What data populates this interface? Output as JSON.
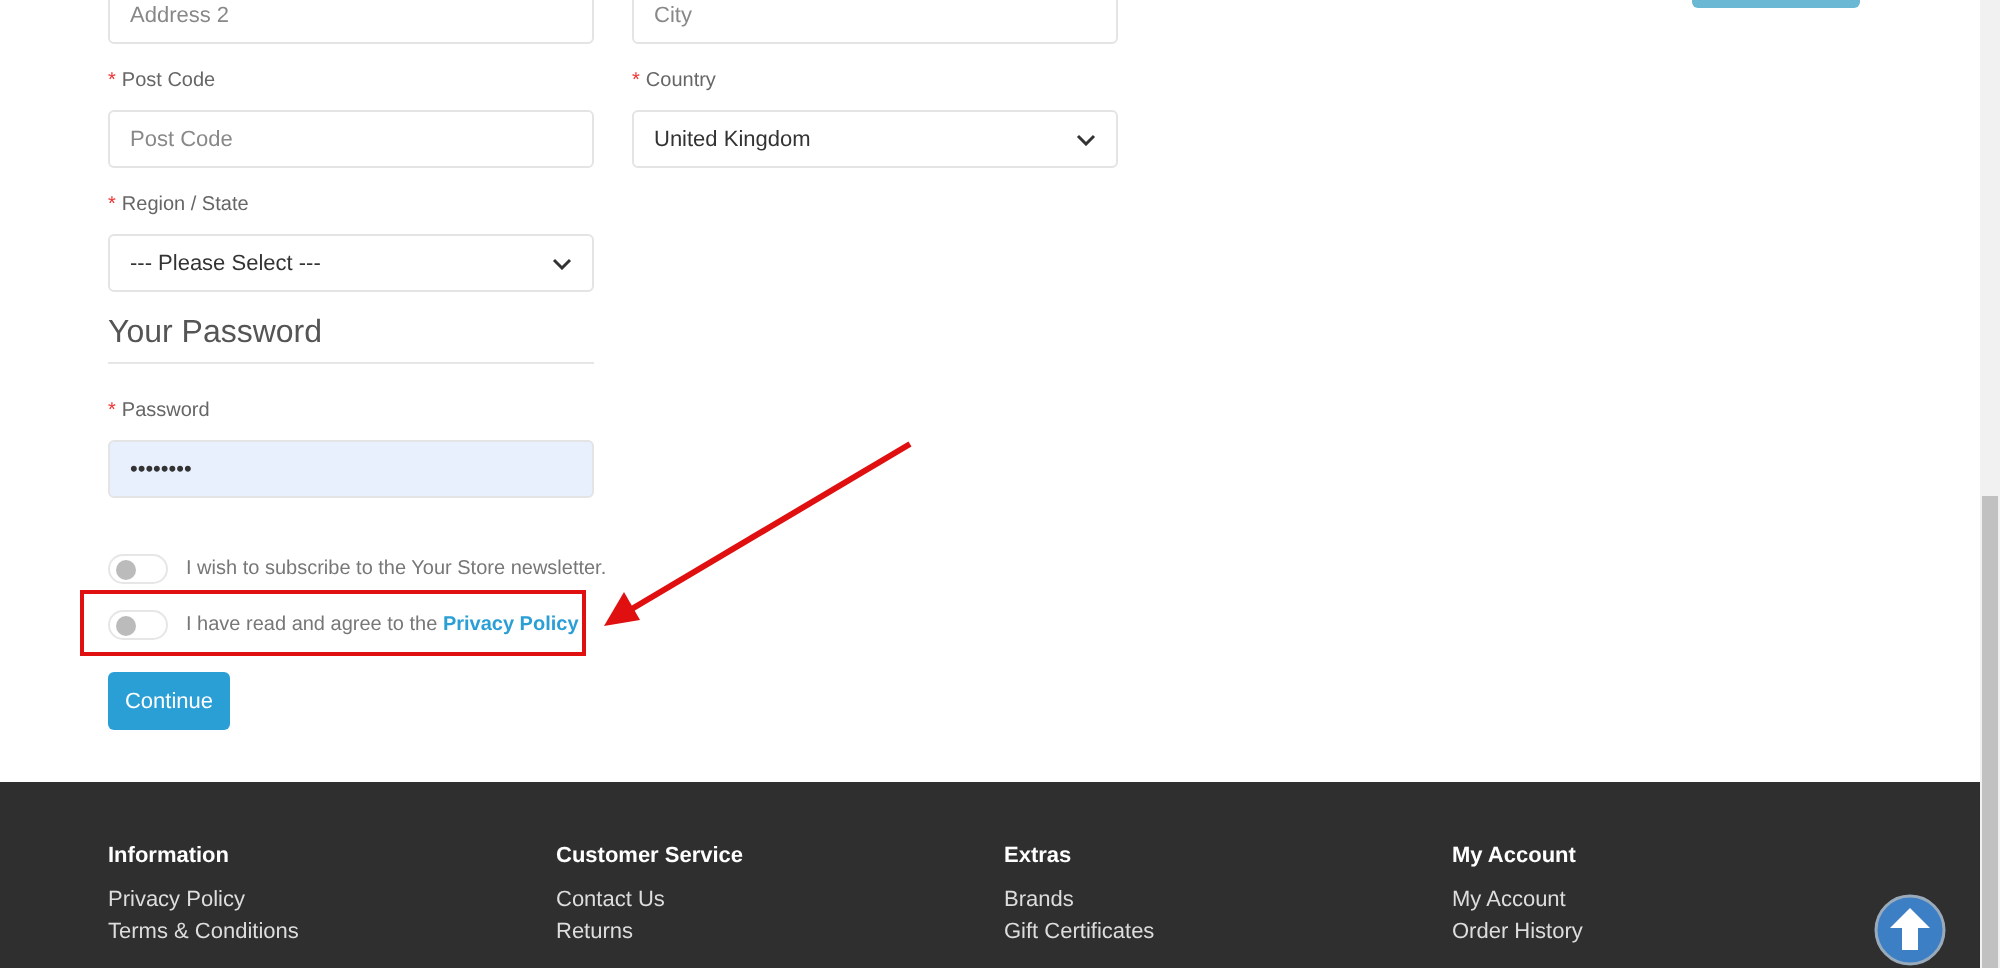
{
  "top_fields": [
    {
      "kind": "text",
      "placeholder": "Address 2"
    },
    {
      "kind": "text",
      "placeholder": "City"
    }
  ],
  "field_rows": [
    [
      {
        "label": "Post Code",
        "required": true,
        "star": "*",
        "kind": "text",
        "placeholder": "Post Code"
      },
      {
        "label": "Country",
        "required": true,
        "star": "*",
        "kind": "select",
        "value": "United Kingdom"
      }
    ],
    [
      {
        "label": "Region / State",
        "required": true,
        "star": "*",
        "kind": "select",
        "value": "--- Please Select ---"
      }
    ]
  ],
  "password_section": {
    "title": "Your Password",
    "field": {
      "label": "Password",
      "required": true,
      "star": "*",
      "kind": "password",
      "value": "••••••••"
    }
  },
  "toggles": [
    {
      "on": false,
      "text": "I wish to subscribe to the Your Store newsletter.",
      "highlighted": false
    },
    {
      "on": false,
      "text": "I have read and agree to the ",
      "link": "Privacy Policy",
      "highlighted": true
    }
  ],
  "submit": "Continue",
  "footer": [
    {
      "heading": "Information",
      "links": [
        "Privacy Policy",
        "Terms & Conditions"
      ]
    },
    {
      "heading": "Customer Service",
      "links": [
        "Contact Us",
        "Returns"
      ]
    },
    {
      "heading": "Extras",
      "links": [
        "Brands",
        "Gift Certificates"
      ]
    },
    {
      "heading": "My Account",
      "links": [
        "My Account",
        "Order History"
      ]
    }
  ]
}
